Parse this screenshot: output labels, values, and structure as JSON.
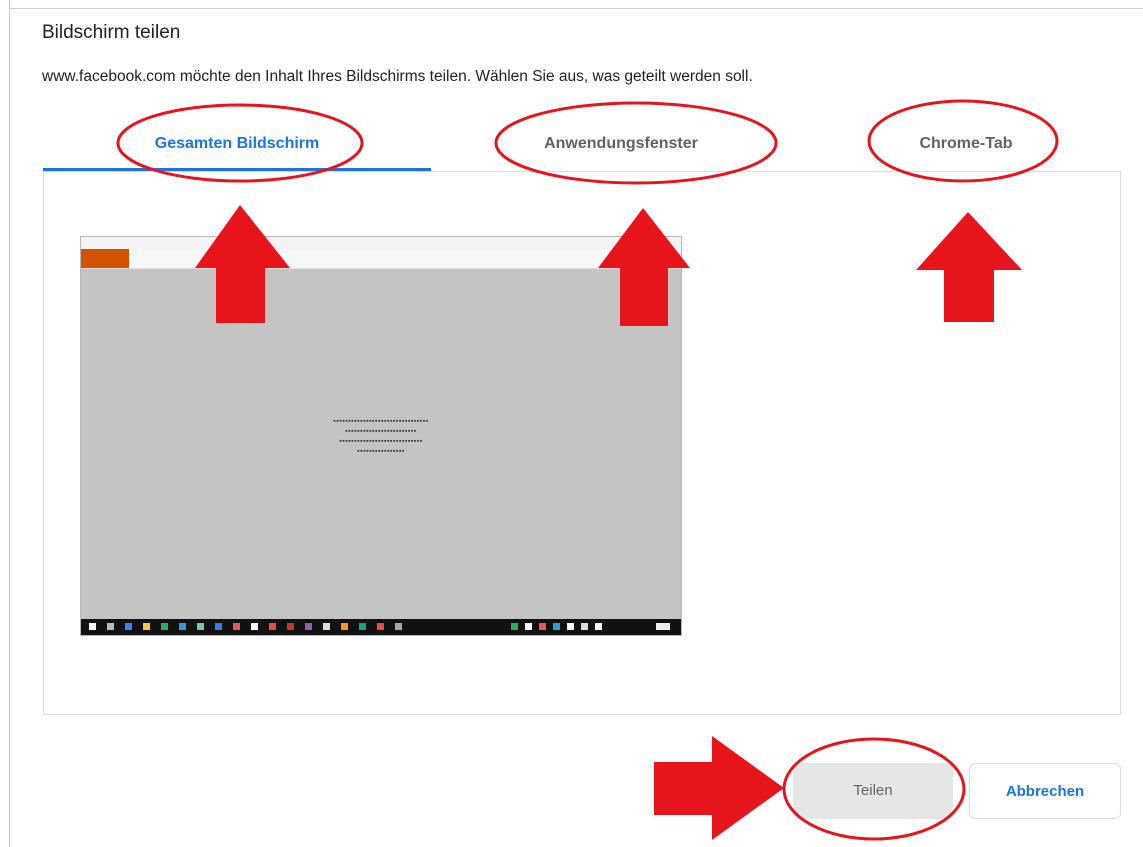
{
  "dialog": {
    "title": "Bildschirm teilen",
    "description": "www.facebook.com möchte den Inhalt Ihres Bildschirms teilen. Wählen Sie aus, was geteilt werden soll."
  },
  "tabs": [
    {
      "label": "Gesamten Bildschirm",
      "active": true
    },
    {
      "label": "Anwendungsfenster",
      "active": false
    },
    {
      "label": "Chrome-Tab",
      "active": false
    }
  ],
  "buttons": {
    "share_label": "Teilen",
    "cancel_label": "Abbrechen"
  },
  "colors": {
    "accent": "#1a73e8",
    "annotation": "#e8141c"
  }
}
